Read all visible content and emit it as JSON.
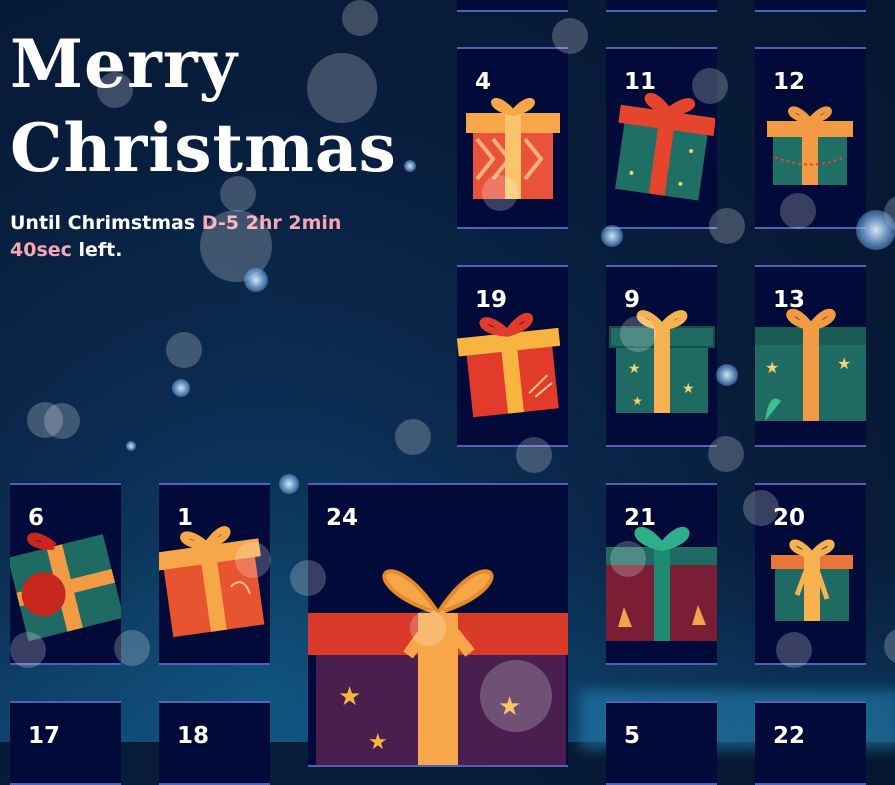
{
  "hero": {
    "title_line1": "Merry",
    "title_line2": "Christmas",
    "countdown_prefix": "Until Chrimstmas ",
    "countdown_days": "D-5",
    "countdown_hours": "2hr",
    "countdown_minutes": "2min",
    "countdown_seconds": "40sec",
    "countdown_suffix": " left."
  },
  "calendar": {
    "cells": [
      {
        "day": "4"
      },
      {
        "day": "11"
      },
      {
        "day": "12"
      },
      {
        "day": "19"
      },
      {
        "day": "9"
      },
      {
        "day": "13"
      },
      {
        "day": "6"
      },
      {
        "day": "1"
      },
      {
        "day": "24"
      },
      {
        "day": "21"
      },
      {
        "day": "20"
      },
      {
        "day": "17"
      },
      {
        "day": "18"
      },
      {
        "day": "5"
      },
      {
        "day": "22"
      }
    ]
  },
  "colors": {
    "background": "#081d3c",
    "cell_background": "#010a38",
    "cell_border": "#4f62b8",
    "countdown_highlight": "#f8a6b4"
  }
}
